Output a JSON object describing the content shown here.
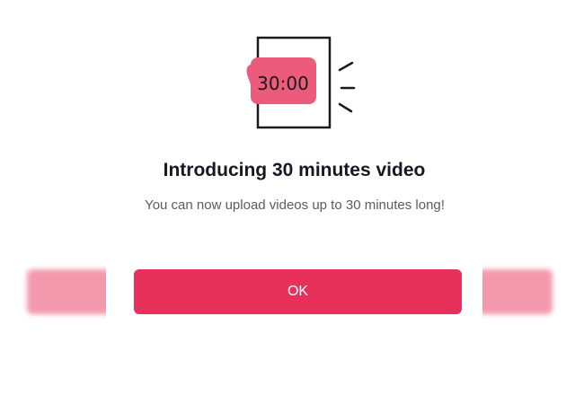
{
  "dialog": {
    "title": "Introducing 30 minutes video",
    "description": "You can now upload videos up to 30 minutes long!",
    "button_label": "OK",
    "illustration_time": "30:00"
  },
  "colors": {
    "accent": "#e8315a",
    "title_text": "#161823",
    "body_text": "#5b5b63",
    "background": "#ffffff"
  },
  "icons": {
    "illustration": "timer-screen-icon"
  }
}
